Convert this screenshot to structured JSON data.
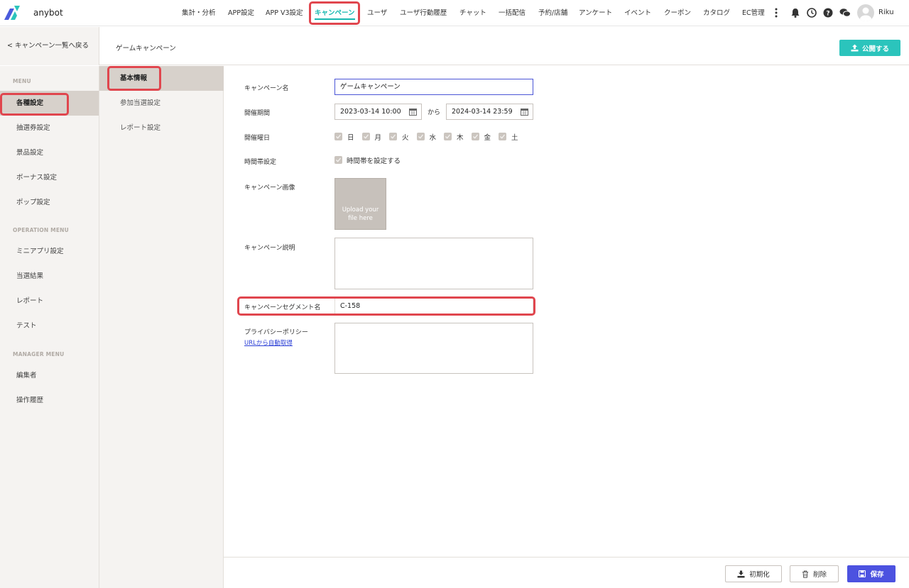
{
  "app": {
    "brand": "anybot",
    "user": "Riku"
  },
  "nav": {
    "items": [
      {
        "label": "集計・分析"
      },
      {
        "label": "APP設定"
      },
      {
        "label": "APP V3設定"
      },
      {
        "label": "キャンペーン"
      },
      {
        "label": "ユーザ"
      },
      {
        "label": "ユーザ行動履歴"
      },
      {
        "label": "チャット"
      },
      {
        "label": "一括配信"
      },
      {
        "label": "予約/店舗"
      },
      {
        "label": "アンケート"
      },
      {
        "label": "イベント"
      },
      {
        "label": "クーポン"
      },
      {
        "label": "カタログ"
      },
      {
        "label": "EC管理"
      }
    ],
    "icons": [
      "more-vertical-icon",
      "bell-icon",
      "clock-icon",
      "help-icon",
      "chat-bubble-icon",
      "user-avatar-icon"
    ]
  },
  "subheader": {
    "back_label": "< キャンペーン一覧へ戻る",
    "page_title": "ゲームキャンペーン",
    "publish_label": "公開する"
  },
  "sidebar": {
    "sections": [
      {
        "title": "MENU",
        "items": [
          "各種設定",
          "抽選券設定",
          "景品設定",
          "ボーナス設定",
          "ポップ設定"
        ]
      },
      {
        "title": "OPERATION MENU",
        "items": [
          "ミニアプリ設定",
          "当選結果",
          "レポート",
          "テスト"
        ]
      },
      {
        "title": "MANAGER MENU",
        "items": [
          "編集者",
          "操作履歴"
        ]
      }
    ]
  },
  "subnav": {
    "items": [
      "基本情報",
      "参加当選設定",
      "レポート設定"
    ]
  },
  "form": {
    "campaign_name": {
      "label": "キャンペーン名",
      "value": "ゲームキャンペーン"
    },
    "period": {
      "label": "開催期間",
      "start": "2023-03-14 10:00",
      "separator": "から",
      "end": "2024-03-14 23:59"
    },
    "weekdays": {
      "label": "開催曜日",
      "days": [
        "日",
        "月",
        "火",
        "水",
        "木",
        "金",
        "土"
      ]
    },
    "time_slot": {
      "label": "時間帯設定",
      "checkbox_label": "時間帯を設定する"
    },
    "image": {
      "label": "キャンペーン画像",
      "upload_line1": "Upload your",
      "upload_line2": "file here"
    },
    "description": {
      "label": "キャンペーン説明",
      "value": ""
    },
    "segment": {
      "label": "キャンペーンセグメント名",
      "value": "C-158"
    },
    "privacy": {
      "label": "プライバシーポリシー",
      "link": "URLから自動取得",
      "value": ""
    }
  },
  "footer": {
    "reset_label": "初期化",
    "delete_label": "削除",
    "save_label": "保存"
  },
  "colors": {
    "accent": "#17b8b0",
    "primary": "#4c52e0",
    "highlight": "#e0464e"
  }
}
